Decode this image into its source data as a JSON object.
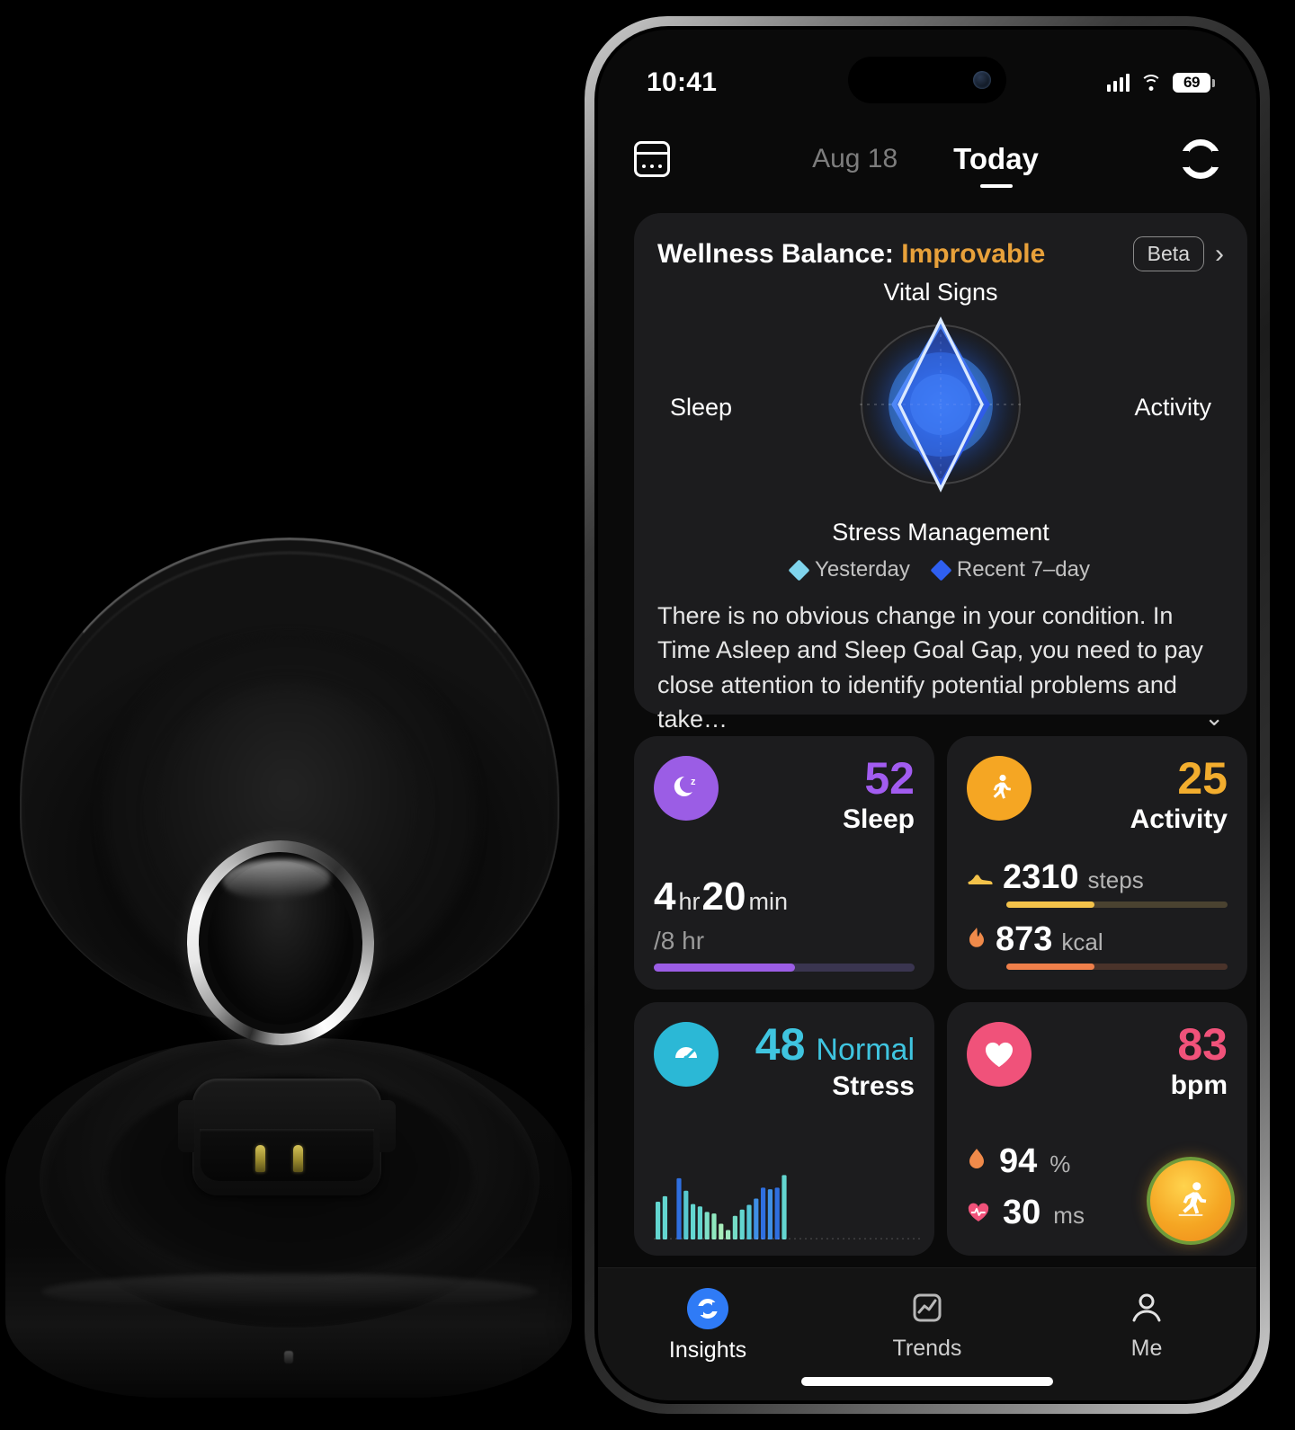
{
  "device": {
    "status_bar": {
      "time": "10:41",
      "battery_level": "69",
      "signal_icon": "cellular-bars-icon",
      "wifi_icon": "wifi-icon",
      "battery_icon": "battery-icon"
    },
    "home_indicator": "home-indicator"
  },
  "header": {
    "calendar_icon": "calendar-icon",
    "previous_date": "Aug 18",
    "current_tab": "Today",
    "sync_icon": "sync-ring-icon"
  },
  "wellness": {
    "title_prefix": "Wellness Balance: ",
    "status": "Improvable",
    "status_color": "#e8a13a",
    "beta_label": "Beta",
    "chevron_right": "›",
    "chevron_down": "⌄",
    "description": "There is no obvious change in your condition. In Time Asleep and Sleep Goal Gap, you need to pay close attention to identify potential problems and take…",
    "legend": [
      {
        "label": "Yesterday",
        "color": "#7fd4ec"
      },
      {
        "label": "Recent 7–day",
        "color": "#2f5ff0"
      }
    ],
    "chart_data": {
      "type": "radar",
      "title": "Wellness Balance",
      "axes": [
        "Vital Signs",
        "Activity",
        "Stress Management",
        "Sleep"
      ],
      "max": 100,
      "grid": false,
      "legend_position": "bottom",
      "series": [
        {
          "name": "Yesterday",
          "color": "#7fd4ec",
          "values": [
            96,
            40,
            96,
            40
          ]
        },
        {
          "name": "Recent 7–day",
          "color": "#2f5ff0",
          "values": [
            82,
            52,
            82,
            52
          ]
        }
      ]
    }
  },
  "metrics": {
    "sleep": {
      "icon": "sleep-moon-icon",
      "icon_bg": "#9b5de5",
      "score": "52",
      "score_color": "#a25cf0",
      "name": "Sleep",
      "duration_hours": "4",
      "hours_unit": "hr",
      "duration_minutes": "20",
      "minutes_unit": "min",
      "goal": "/8 hr",
      "progress_percent": 54,
      "bar_color": "#9b5de5",
      "bar_track_color": "#3a3550"
    },
    "activity": {
      "icon": "running-person-icon",
      "icon_bg": "#f5a623",
      "score": "25",
      "score_color": "#f2ad2e",
      "name": "Activity",
      "rows": [
        {
          "icon": "shoe-icon",
          "value": "2310",
          "unit": "steps",
          "progress_percent": 40,
          "color": "#f3c24a",
          "track_color": "#4a4230"
        },
        {
          "icon": "flame-icon",
          "value": "873",
          "unit": "kcal",
          "progress_percent": 40,
          "color": "#ef7f4a",
          "track_color": "#4a332a"
        }
      ]
    },
    "stress": {
      "icon": "stress-gauge-icon",
      "icon_bg": "#2bb8d6",
      "score": "48",
      "score_color": "#3fc5e0",
      "status": "Normal",
      "status_color": "#3fc5e0",
      "name": "Stress",
      "chart_data": {
        "type": "bar",
        "title": "Stress trend",
        "categories": [
          "1",
          "2",
          "3",
          "4",
          "5",
          "6",
          "7",
          "8",
          "9",
          "10",
          "11",
          "12",
          "13",
          "14",
          "15",
          "16",
          "17",
          "18"
        ],
        "values": [
          48,
          55,
          0,
          78,
          62,
          45,
          42,
          35,
          33,
          20,
          12,
          30,
          38,
          44,
          52,
          66,
          64,
          66,
          82
        ],
        "colors": [
          "#63d6d0",
          "#63d6d0",
          "#2f6fe0",
          "#2f6fe0",
          "#57c9cf",
          "#63d6d0",
          "#63d6d0",
          "#7fe0c7",
          "#8fe8bf",
          "#a8edbb",
          "#9fe9c0",
          "#74dcc6",
          "#63d6d0",
          "#55c7d6",
          "#3f8fe6",
          "#2f6fe0",
          "#3f8fe6",
          "#2f6fe0"
        ],
        "ylim": [
          0,
          100
        ],
        "grid": false
      }
    },
    "heart": {
      "icon": "heart-icon",
      "icon_bg": "#f0527a",
      "value": "83",
      "value_color": "#f0527a",
      "unit": "bpm",
      "rows": [
        {
          "icon": "blood-oxygen-drop-icon",
          "value": "94",
          "unit": "%"
        },
        {
          "icon": "hrv-heart-pulse-icon",
          "value": "30",
          "unit": "ms"
        }
      ],
      "fab_icon": "running-person-fab-icon"
    }
  },
  "tabbar": [
    {
      "label": "Insights",
      "icon": "insights-ring-icon",
      "active": true
    },
    {
      "label": "Trends",
      "icon": "trends-chart-icon",
      "active": false
    },
    {
      "label": "Me",
      "icon": "person-icon",
      "active": false
    }
  ],
  "product": {
    "case_lid": "charging-case-lid",
    "case_base": "charging-case-base",
    "ring": "smart-ring",
    "charging_pins": "charging-pins"
  }
}
